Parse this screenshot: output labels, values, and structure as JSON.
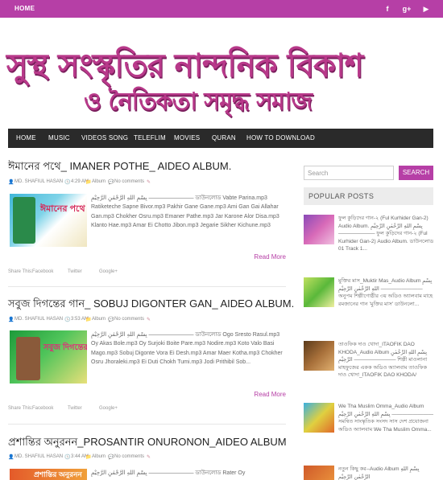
{
  "topbar": {
    "home": "HOME",
    "social": [
      "f",
      "g+",
      "▶"
    ]
  },
  "logo": {
    "line1": "সুস্থ সংস্কৃতির নান্দনিক বিকাশ",
    "line2": "ও নৈতিকতা সমৃদ্ধ সমাজ"
  },
  "nav": [
    "HOME",
    "MUSIC",
    "VIDEOS SONG",
    "TELEFLIM",
    "MOVIES",
    "QURAN",
    "HOW TO DOWNLOAD"
  ],
  "posts": [
    {
      "title": "ঈমানের পথে_ IMANER POTHE_ AIDEO ALBUM.",
      "author": "MD. SHAFIUL HASAN",
      "time": "4:29 AM",
      "label": "Album",
      "comments": "No comments",
      "excerpt": "بِسْمِ اللهِ الرَّحْمٰنِ الرَّحِيْمِ ———————— ডাউনলোড Vabte Parina.mp3 Ratiketeche Sapne Bivor.mp3 Pakhir Gane Gane.mp3 Ami Gan Gai Allahar Gan.mp3 Chokher Osru.mp3 Emaner Pathe.mp3 Jar Karone Alor Disa.mp3 Klanto Hae.mp3 Amar Ei Chotto Jibon.mp3 Jegarie Sikher Kichune.mp3",
      "read_more": "Read More",
      "share": [
        "Share This:",
        "Facebook",
        "Twitter",
        "Google+"
      ],
      "thumb_text": "ঈমানের পথে"
    },
    {
      "title": "সবুজ দিগন্তের গান_ SOBUJ DIGONTER GAN_ AIDEO ALBUM.",
      "author": "MD. SHAFIUL HASAN",
      "time": "3:53 AM",
      "label": "Album",
      "comments": "No comments",
      "excerpt": "بِسْمِ اللهِ الرَّحْمٰنِ الرَّحِيْمِ ———————— ডাউনলোড Ogo Sresto Rasul.mp3 Oy Akas Bole.mp3 Oy Surjoki Boite Pare.mp3 Nodire.mp3 Koto Valo Basi Mago.mp3 Sobuj Digonte Vora Ei Desh.mp3 Amar Maer Kotha.mp3 Chokher Osru Jhoraleki.mp3 Ei Duti Chokh Tumi.mp3 Jodi Prithibil Sob...",
      "read_more": "Read More",
      "share": [
        "Share This:",
        "Facebook",
        "Twitter",
        "Google+"
      ],
      "thumb_text": "সবুজ দিগন্তের গান"
    },
    {
      "title": "প্রশান্তির অনুরনন_PROSANTIR ONURONON_AIDEO ALBUM.",
      "author": "MD. SHAFIUL HASAN",
      "time": "3:44 AM",
      "label": "Album",
      "comments": "No comments",
      "excerpt": "بِسْمِ اللهِ الرَّحْمٰنِ الرَّحِيْمِ ———————— ডাউনলোড Rater Oy",
      "thumb_text": "প্রশান্তির অনুরনন"
    }
  ],
  "sidebar": {
    "search_placeholder": "Search",
    "search_button": "SEARCH",
    "popular_title": "POPULAR POSTS",
    "popular": [
      {
        "text": "ফুল কুড়িদের গান-২ (Ful Kurhider Gan-2) Audio Album. بِسْمِ اللهِ الرَّحْمٰنِ الرَّحِيْمِ ——————— ফুল কুড়িদের গান-২ (Ful Kurhider Gan-2) Audio Album. ডাউনলোড 01 Track 1..."
      },
      {
        "text": "মুক্তির মাস_Muktir Mas_Audio Album بِسْمِ اللهِ الرَّحْمٰنِ الرَّحِيْمِ ———————— অনুপম শিল্পীগোষ্ঠীর ৩য় অডিও অ্যালবাম মাহে রমজানের গান 'মুক্তির মাস' ডাউনলো..."
      },
      {
        "text": "তাওফিক দাও খোদা_ITAOFIK DAO KHODA_Audio Album بِسْمِ اللهِ الرَّحْمٰنِ الرَّحِيْمِ ———————— শিল্পী মাওলানা মাহফুজের একক অডিও অ্যালবাম তাওফিক দাও খোদা_ITAOFIK DAO KHODA/"
      },
      {
        "text": "We Tha Muslim Omma_Audio Album بِسْمِ اللهِ الرَّحْمٰنِ الرَّحِيْمِ ———————— সমন্বিত সাংস্কৃতিক সংসদ সাস দেশ প্রযোজনা অডিও অ্যালবাম We Tha Muslim Omma..."
      },
      {
        "text": "নতুন কিছু কর--Audio Album بِسْمِ اللهِ الرَّحْمٰنِ الرَّحِيْمِ"
      }
    ]
  }
}
